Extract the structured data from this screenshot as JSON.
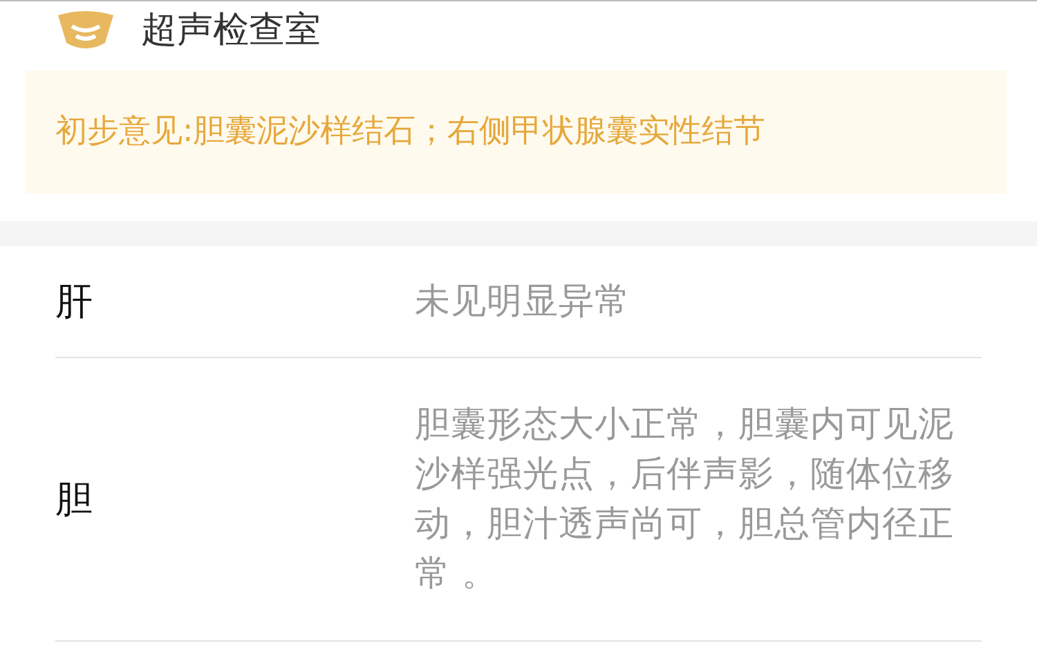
{
  "header": {
    "title": "超声检查室"
  },
  "notice": {
    "text": "初步意见:胆囊泥沙样结石；右侧甲状腺囊实性结节"
  },
  "findings": [
    {
      "organ": "肝",
      "result": "未见明显异常"
    },
    {
      "organ": "胆",
      "result": "胆囊形态大小正常，胆囊内可见泥沙样强光点，后伴声影，随体位移动，胆汁透声尚可，胆总管内径正常 。"
    }
  ]
}
